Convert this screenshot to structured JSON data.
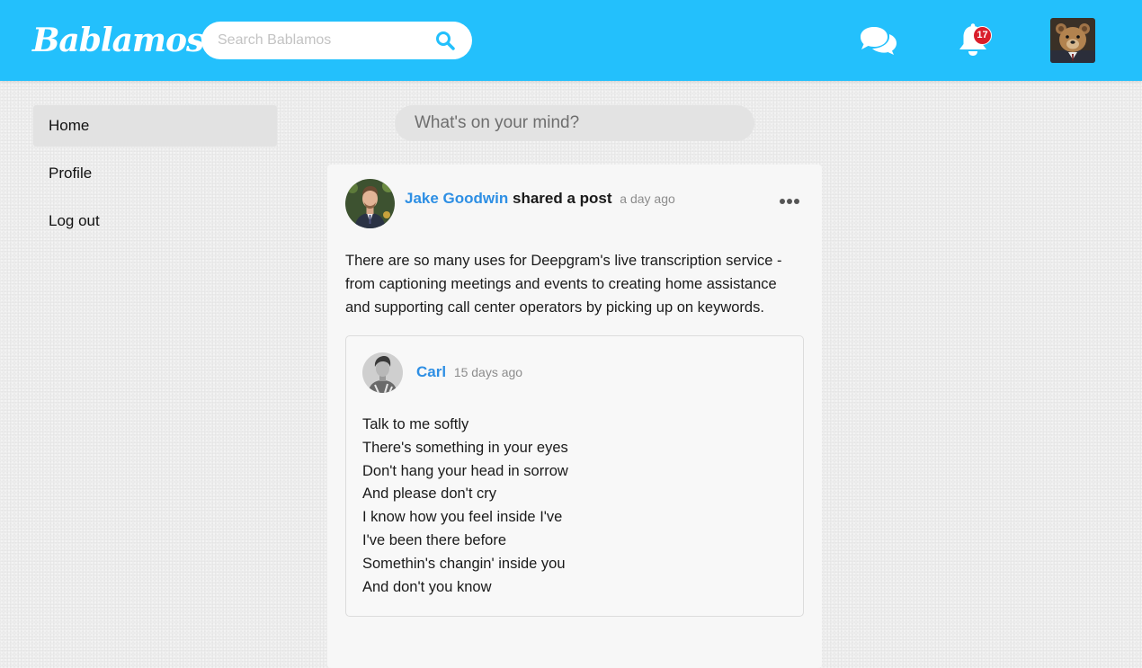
{
  "app": {
    "name": "Bablamos"
  },
  "header": {
    "search_placeholder": "Search Bablamos",
    "notification_count": "17",
    "brand_color": "#23c0fc"
  },
  "sidebar": {
    "items": [
      {
        "label": "Home",
        "active": true
      },
      {
        "label": "Profile",
        "active": false
      },
      {
        "label": "Log out",
        "active": false
      }
    ]
  },
  "composer": {
    "placeholder": "What's on your mind?"
  },
  "post": {
    "author": "Jake Goodwin",
    "action": "shared a post",
    "time": "a day ago",
    "text": "There are so many uses for Deepgram's live transcription service - from captioning meetings and events to creating home assistance and supporting call center operators by picking up on keywords.",
    "shared": {
      "author": "Carl",
      "time": "15 days ago",
      "lines": [
        "Talk to me softly",
        "There's something in your eyes",
        "Don't hang your head in sorrow",
        "And please don't cry",
        "I know how you feel inside I've",
        "I've been there before",
        "Somethin's changin' inside you",
        "And don't you know"
      ]
    }
  }
}
